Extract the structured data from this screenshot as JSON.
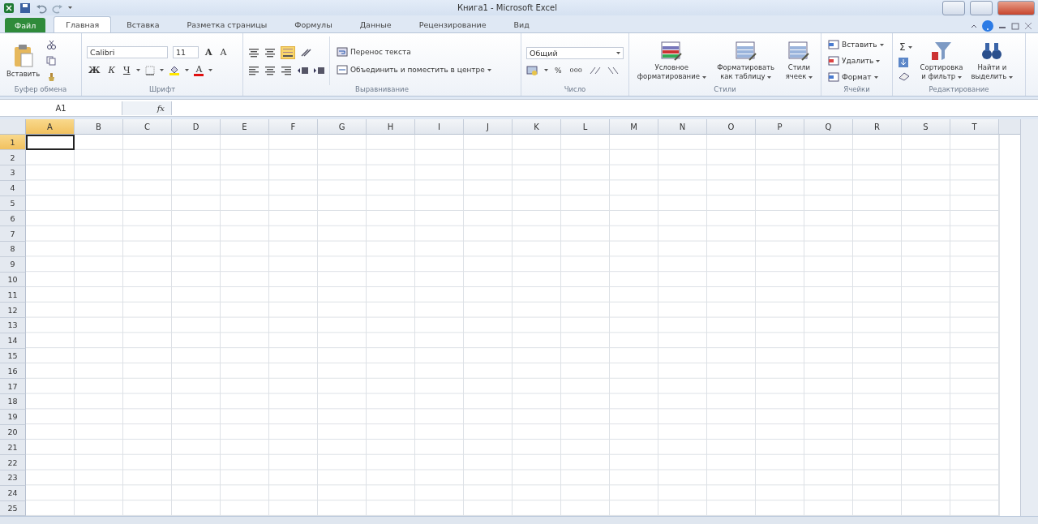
{
  "window": {
    "title": "Книга1 - Microsoft Excel"
  },
  "tabs": [
    {
      "label": "Файл",
      "kind": "file",
      "selected": false
    },
    {
      "label": "Главная",
      "kind": "tab",
      "selected": true
    },
    {
      "label": "Вставка",
      "kind": "tab",
      "selected": false
    },
    {
      "label": "Разметка страницы",
      "kind": "tab",
      "selected": false
    },
    {
      "label": "Формулы",
      "kind": "tab",
      "selected": false
    },
    {
      "label": "Данные",
      "kind": "tab",
      "selected": false
    },
    {
      "label": "Рецензирование",
      "kind": "tab",
      "selected": false
    },
    {
      "label": "Вид",
      "kind": "tab",
      "selected": false
    }
  ],
  "ribbon": {
    "groups": [
      {
        "kind": "clipboard",
        "label": "Буфер обмена",
        "paste": "Вставить"
      },
      {
        "kind": "font",
        "label": "Шрифт",
        "font_name": "Calibri",
        "font_size": "11",
        "grow": "A",
        "shrink": "A",
        "bold": "Ж",
        "italic": "К",
        "underline": "Ч",
        "font_color": "A"
      },
      {
        "kind": "alignment",
        "label": "Выравнивание",
        "wrap": "Перенос текста",
        "merge": "Объединить и поместить в центре"
      },
      {
        "kind": "number",
        "label": "Число",
        "format": "Общий",
        "percent": "%",
        "thousands": "000"
      },
      {
        "kind": "styles",
        "label": "Стили",
        "buttons": [
          [
            "Условное",
            "форматирование"
          ],
          [
            "Форматировать",
            "как таблицу"
          ],
          [
            "Стили",
            "ячеек"
          ]
        ]
      },
      {
        "kind": "cells",
        "label": "Ячейки",
        "buttons": [
          "Вставить",
          "Удалить",
          "Формат"
        ]
      },
      {
        "kind": "editing",
        "label": "Редактирование",
        "sum": "Σ",
        "buttons": [
          [
            "Сортировка",
            "и фильтр"
          ],
          [
            "Найти и",
            "выделить"
          ]
        ]
      }
    ]
  },
  "formula_bar": {
    "name_box": "A1",
    "fx": "fx"
  },
  "sheet": {
    "columns": [
      {
        "label": "A",
        "selected": true
      },
      {
        "label": "B",
        "selected": false
      },
      {
        "label": "C",
        "selected": false
      },
      {
        "label": "D",
        "selected": false
      },
      {
        "label": "E",
        "selected": false
      },
      {
        "label": "F",
        "selected": false
      },
      {
        "label": "G",
        "selected": false
      },
      {
        "label": "H",
        "selected": false
      },
      {
        "label": "I",
        "selected": false
      },
      {
        "label": "J",
        "selected": false
      },
      {
        "label": "K",
        "selected": false
      },
      {
        "label": "L",
        "selected": false
      },
      {
        "label": "M",
        "selected": false
      },
      {
        "label": "N",
        "selected": false
      },
      {
        "label": "O",
        "selected": false
      },
      {
        "label": "P",
        "selected": false
      },
      {
        "label": "Q",
        "selected": false
      },
      {
        "label": "R",
        "selected": false
      },
      {
        "label": "S",
        "selected": false
      },
      {
        "label": "T",
        "selected": false
      }
    ],
    "rows": [
      {
        "label": "1",
        "selected": true
      },
      {
        "label": "2",
        "selected": false
      },
      {
        "label": "3",
        "selected": false
      },
      {
        "label": "4",
        "selected": false
      },
      {
        "label": "5",
        "selected": false
      },
      {
        "label": "6",
        "selected": false
      },
      {
        "label": "7",
        "selected": false
      },
      {
        "label": "8",
        "selected": false
      },
      {
        "label": "9",
        "selected": false
      },
      {
        "label": "10",
        "selected": false
      },
      {
        "label": "11",
        "selected": false
      },
      {
        "label": "12",
        "selected": false
      },
      {
        "label": "13",
        "selected": false
      },
      {
        "label": "14",
        "selected": false
      },
      {
        "label": "15",
        "selected": false
      },
      {
        "label": "16",
        "selected": false
      },
      {
        "label": "17",
        "selected": false
      },
      {
        "label": "18",
        "selected": false
      },
      {
        "label": "19",
        "selected": false
      },
      {
        "label": "20",
        "selected": false
      },
      {
        "label": "21",
        "selected": false
      },
      {
        "label": "22",
        "selected": false
      },
      {
        "label": "23",
        "selected": false
      },
      {
        "label": "24",
        "selected": false
      },
      {
        "label": "25",
        "selected": false
      }
    ]
  }
}
